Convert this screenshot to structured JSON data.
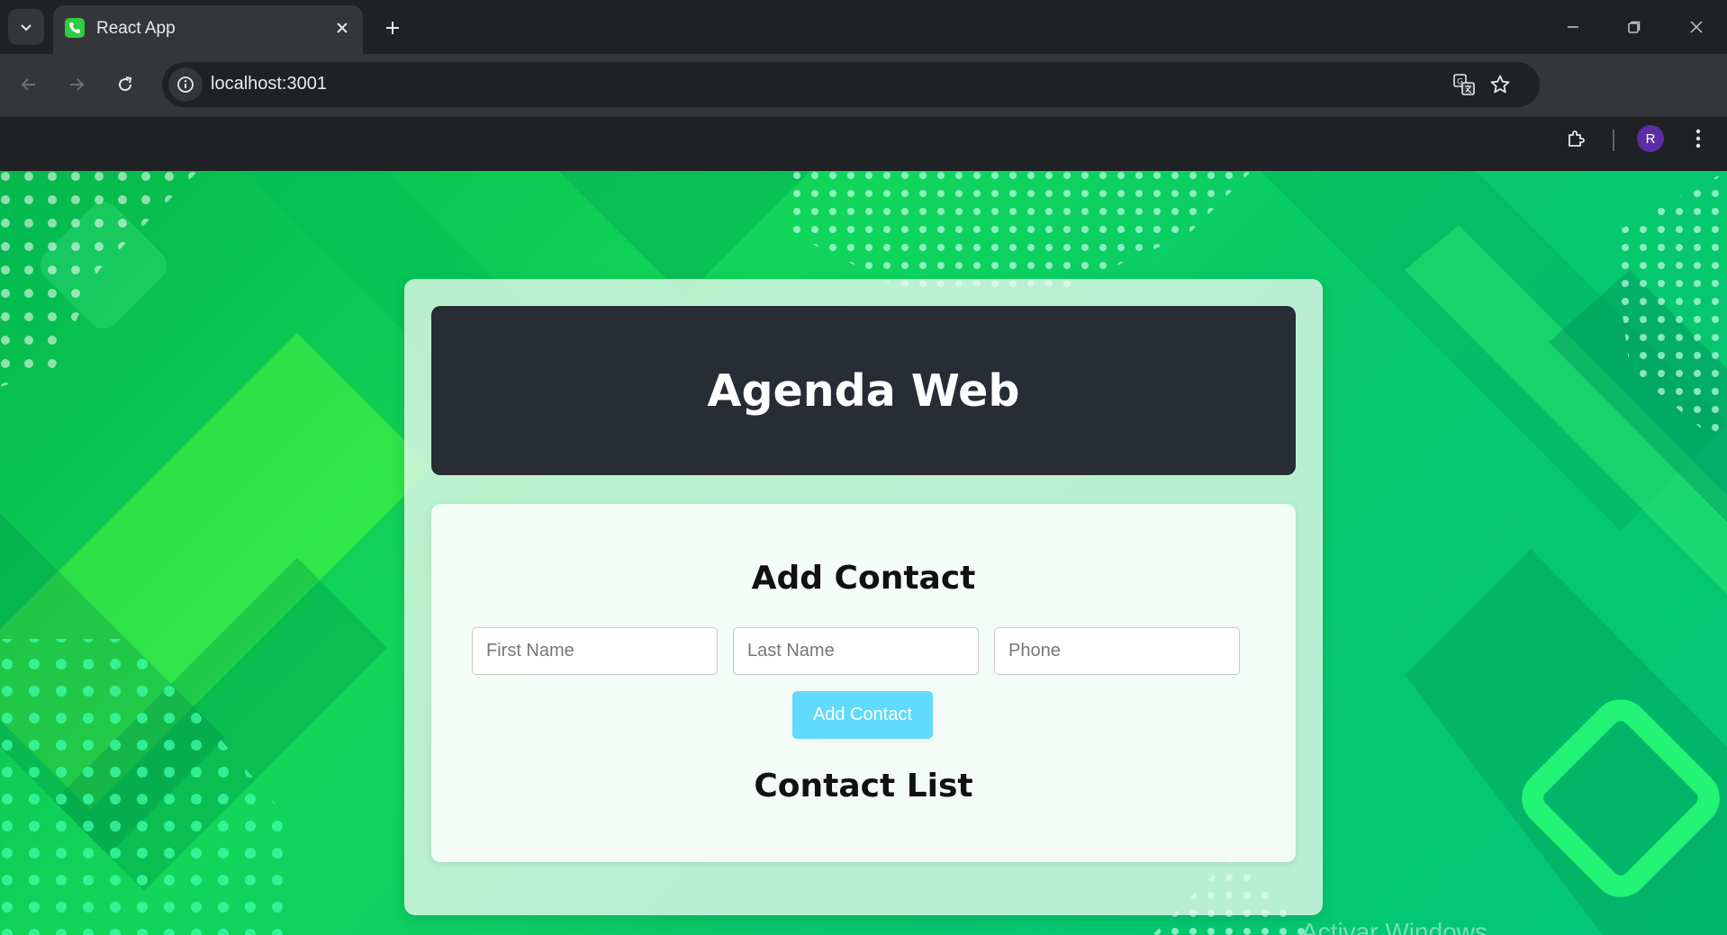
{
  "browser": {
    "tab_title": "React App",
    "url": "localhost:3001",
    "avatar_initial": "R",
    "icons": [
      "tab-search-icon",
      "phone-favicon-icon",
      "close-icon",
      "plus-icon",
      "minimize-icon",
      "restore-icon",
      "window-close-icon",
      "back-arrow-icon",
      "forward-arrow-icon",
      "reload-icon",
      "site-info-icon",
      "translate-icon",
      "star-icon",
      "extensions-icon",
      "kebab-menu-icon"
    ]
  },
  "app": {
    "title": "Agenda Web",
    "form": {
      "heading": "Add Contact",
      "first_name_placeholder": "First Name",
      "last_name_placeholder": "Last Name",
      "phone_placeholder": "Phone",
      "first_name_value": "",
      "last_name_value": "",
      "phone_value": "",
      "submit_label": "Add Contact"
    },
    "list": {
      "heading": "Contact List",
      "contacts": []
    }
  },
  "colors": {
    "header_bg": "#282c34",
    "button_bg": "#61dafb",
    "background_green": "#11d65a"
  },
  "watermark": "Activar Windows"
}
